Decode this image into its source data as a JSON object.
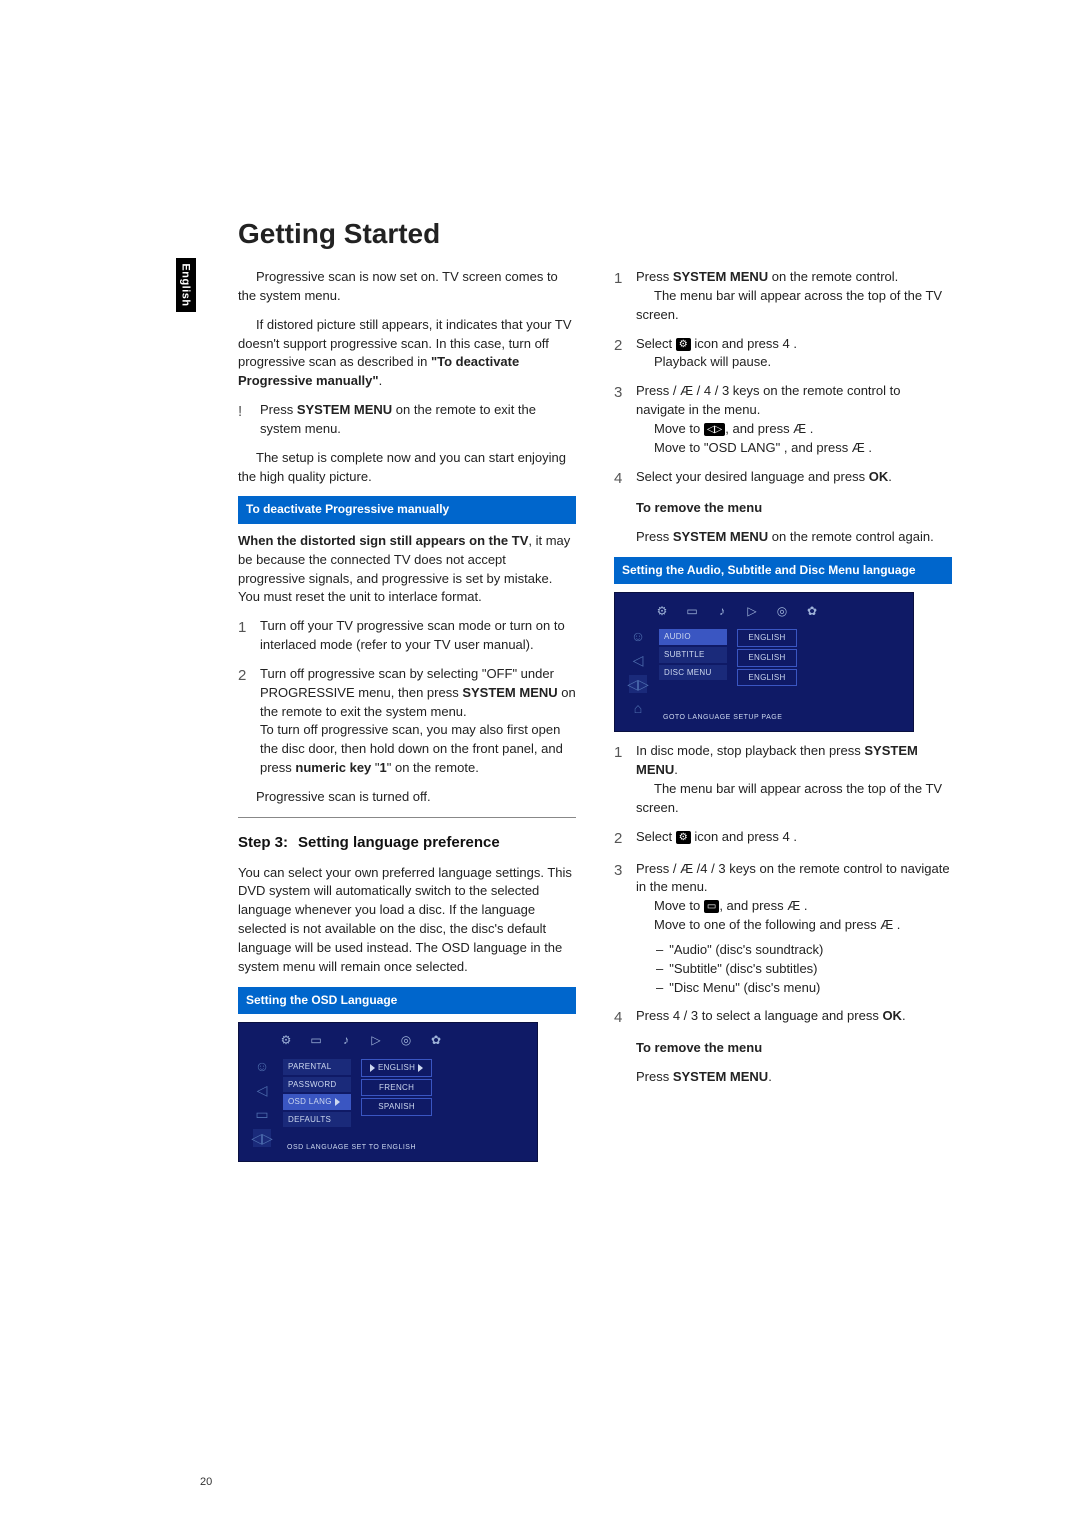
{
  "side_tab": "English",
  "title": "Getting Started",
  "left": {
    "p1a": "Progressive scan is now set on. TV screen comes to the system menu.",
    "p1b": "If distored picture still appears, it indicates that your TV doesn't support progressive scan. In this case, turn off progressive scan as described in ",
    "p1b_bold": "\"To deactivate Progressive manually\"",
    "p1b_end": ".",
    "bang_label": "!",
    "bang_txt_a": "Press ",
    "bang_txt_b": "SYSTEM MENU",
    "bang_txt_c": " on the remote to exit the system menu.",
    "p2": "The setup is complete now and you can start enjoying the high quality picture.",
    "callout1": "To deactivate Progressive manually",
    "p3a": "When the distorted sign still appears on the TV",
    "p3b": ", it may be because the connected TV does not accept progressive signals, and progressive is set by mistake. You must reset the unit to interlace format.",
    "s1_num": "1",
    "s1_txt": "Turn off your TV progressive scan mode or turn on to interlaced mode (refer to your TV user manual).",
    "s2_num": "2",
    "s2_txt_a": "Turn off progressive scan by selecting \"OFF\" under PROGRESSIVE menu, then press ",
    "s2_txt_b": "SYSTEM MENU",
    "s2_txt_c": " on the remote to exit the system menu.",
    "s2_txt_d": "To turn off progressive scan, you may also first open the disc door, then hold down  on the front panel, and press ",
    "s2_txt_e": "numeric key",
    "s2_txt_f": " \"",
    "s2_txt_g": "1",
    "s2_txt_h": "\" on the remote.",
    "p4": "Progressive scan is turned off.",
    "step3_label": "Step 3:",
    "step3_title": "Setting language preference",
    "p5": "You can select your own preferred language settings. This DVD system will automatically switch to the selected language whenever you load a disc. If the language selected is not available on the disc, the disc's default language will be used instead. The OSD language in the system menu will remain once selected.",
    "callout2": "Setting the OSD Language",
    "tv1": {
      "menu": [
        "PARENTAL",
        "PASSWORD",
        "OSD LANG",
        "DEFAULTS"
      ],
      "sub": [
        "ENGLISH",
        "FRENCH",
        "SPANISH"
      ],
      "footer": "OSD LANGUAGE SET TO ENGLISH"
    }
  },
  "right": {
    "s1_num": "1",
    "s1_a": "Press ",
    "s1_b": "SYSTEM MENU",
    "s1_c": " on the remote control.",
    "s1_d": "The menu bar will appear across the top of the TV screen.",
    "s2_num": "2",
    "s2_a": "Select ",
    "s2_b": " icon and press 4 .",
    "s2_c": "Playback will pause.",
    "s3_num": "3",
    "s3_a": "Press   / Æ  / 4  / 3  keys on the remote control to navigate in the menu.",
    "s3_b": "Move to ",
    "s3_c": ", and press Æ .",
    "s3_d": "Move to \"OSD LANG\" , and press Æ .",
    "s4_num": "4",
    "s4_a": "Select your desired language and press ",
    "s4_b": "OK",
    "s4_c": ".",
    "remove_head": "To remove the menu",
    "remove_a": "Press ",
    "remove_b": "SYSTEM MENU",
    "remove_c": " on the remote control again.",
    "callout3": "Setting the Audio,  Subtitle and Disc Menu language",
    "tv2": {
      "menu": [
        "AUDIO",
        "SUBTITLE",
        "DISC MENU"
      ],
      "sub": [
        "ENGLISH",
        "ENGLISH",
        "ENGLISH"
      ],
      "footer": "GOTO LANGUAGE SETUP PAGE"
    },
    "b1_num": "1",
    "b1_a": "In disc mode, stop playback then press ",
    "b1_b": "SYSTEM MENU",
    "b1_c": ".",
    "b1_d": "The menu bar will appear across the top of the TV screen.",
    "b2_num": "2",
    "b2_a": "Select ",
    "b2_b": " icon and press 4 .",
    "b3_num": "3",
    "b3_a": "Press   / Æ  /4  / 3  keys on the remote control to navigate in the menu.",
    "b3_b": "Move to ",
    "b3_c": ", and press Æ .",
    "b3_d": "Move to one of the following and press Æ .",
    "opt1": "\"Audio\" (disc's soundtrack)",
    "opt2": "\"Subtitle\" (disc's subtitles)",
    "opt3": "\"Disc Menu\" (disc's menu)",
    "b4_num": "4",
    "b4_a": "Press 4  / 3   to select a language and press ",
    "b4_b": "OK",
    "b4_c": ".",
    "remove2_head": "To remove the menu",
    "remove2_a": "Press ",
    "remove2_b": "SYSTEM MENU",
    "remove2_c": "."
  },
  "page_number": "20"
}
